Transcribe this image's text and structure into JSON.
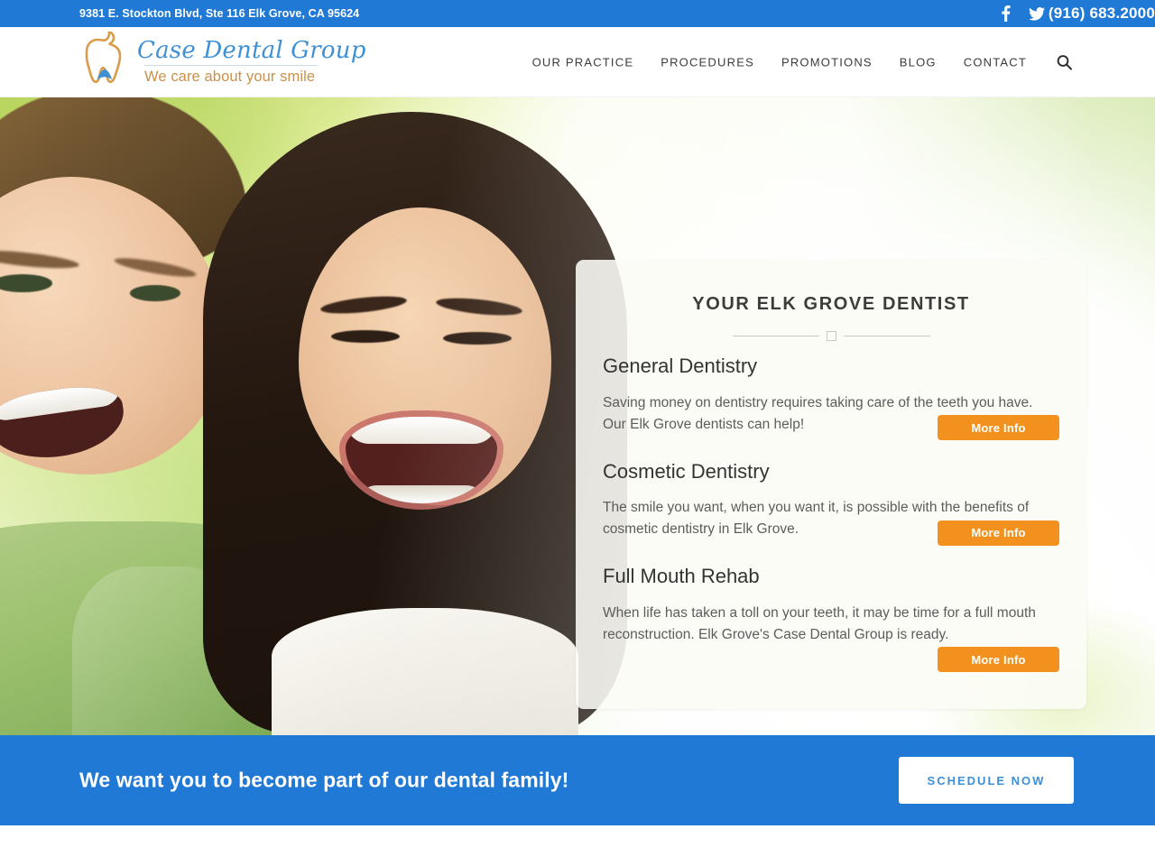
{
  "topbar": {
    "address": "9381 E. Stockton Blvd, Ste 116 Elk Grove, CA 95624",
    "phone": "(916) 683.2000",
    "social": [
      {
        "name": "facebook-icon",
        "label": "Facebook"
      },
      {
        "name": "twitter-icon",
        "label": "Twitter"
      }
    ],
    "background_color": "#2179d6"
  },
  "header": {
    "logo": {
      "title": "Case Dental Group",
      "tagline": "We care about your smile",
      "title_color": "#3f91d4",
      "tagline_color": "#c9914c",
      "mark": "tooth-icon"
    },
    "nav": [
      {
        "label": "OUR PRACTICE"
      },
      {
        "label": "PROCEDURES"
      },
      {
        "label": "PROMOTIONS"
      },
      {
        "label": "BLOG"
      },
      {
        "label": "CONTACT"
      }
    ],
    "search_icon": "search-icon"
  },
  "hero": {
    "image_alt": "Laughing man and woman outdoors",
    "card": {
      "title": "YOUR ELK GROVE DENTIST",
      "services": [
        {
          "title": "General Dentistry",
          "description": "Saving money on dentistry requires taking care of the teeth you have. Our Elk Grove dentists can help!",
          "button": "More Info"
        },
        {
          "title": "Cosmetic Dentistry",
          "description": "The smile you want, when you want it, is possible with the benefits of cosmetic dentistry in Elk Grove.",
          "button": "More Info"
        },
        {
          "title": "Full Mouth Rehab",
          "description": "When life has taken a toll on your teeth, it may be time for a full mouth reconstruction. Elk Grove's Case Dental Group is ready.",
          "button": "More Info"
        }
      ],
      "button_color": "#f3911e"
    }
  },
  "cta": {
    "heading": "We want you to become part of our dental family!",
    "button": "SCHEDULE NOW",
    "background_color": "#2179d6",
    "button_text_color": "#3d8fd8"
  }
}
